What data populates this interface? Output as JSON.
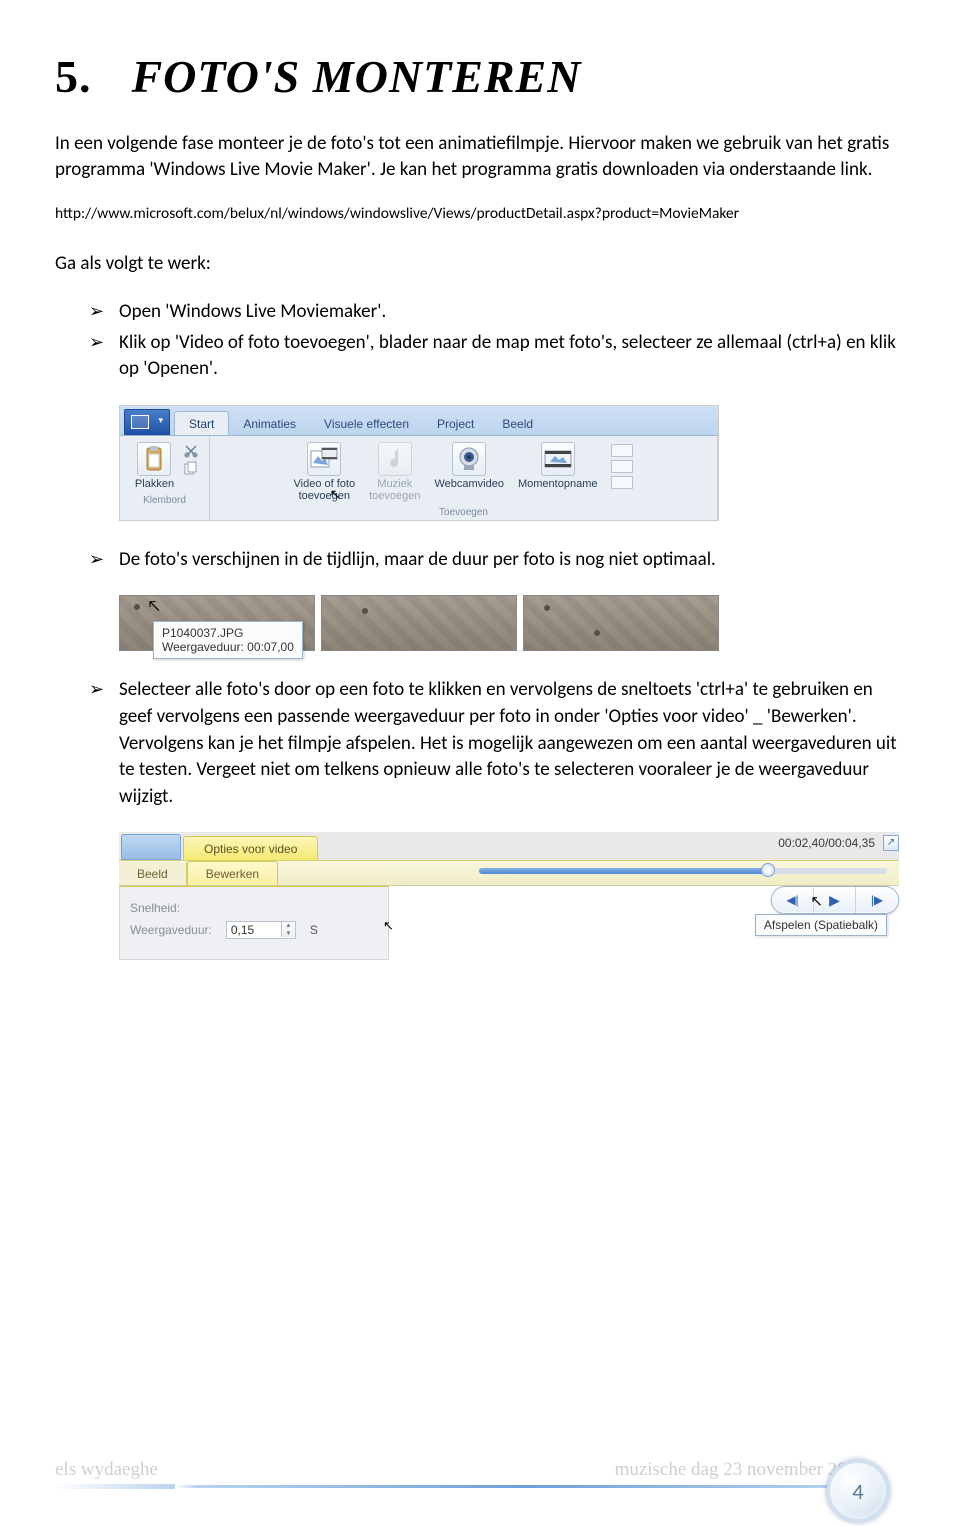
{
  "heading": {
    "number": "5.",
    "title": "FOTO'S MONTEREN"
  },
  "intro": "In een volgende fase monteer je de foto's tot een animatiefilmpje. Hiervoor maken we gebruik van het gratis programma 'Windows Live Movie Maker'. Je kan het programma gratis downloaden via onderstaande link.",
  "link": "http://www.microsoft.com/belux/nl/windows/windowslive/Views/productDetail.aspx?product=MovieMaker",
  "steps_intro": "Ga als volgt te werk:",
  "bullets": {
    "b1": "Open 'Windows Live Moviemaker'.",
    "b2": "Klik op 'Video of foto toevoegen', blader naar de map met foto's, selecteer ze allemaal (ctrl+a) en klik op 'Openen'.",
    "b3": "De foto's verschijnen in de tijdlijn, maar de duur per foto is nog niet optimaal.",
    "b4": "Selecteer alle foto's door op een foto te klikken en vervolgens de sneltoets 'ctrl+a' te gebruiken en geef vervolgens een passende weergaveduur per foto in onder 'Opties voor video' _ 'Bewerken'. Vervolgens kan je het filmpje afspelen. Het is mogelijk aangewezen om een aantal weergaveduren uit te testen. Vergeet niet om telkens opnieuw alle foto's te selecteren vooraleer je de weergaveduur wijzigt."
  },
  "ribbon": {
    "tabs": {
      "start": "Start",
      "animaties": "Animaties",
      "visuele": "Visuele effecten",
      "project": "Project",
      "beeld": "Beeld"
    },
    "items": {
      "plakken": "Plakken",
      "video": "Video of foto\ntoevoegen",
      "muziek": "Muziek\ntoevoegen",
      "webcam": "Webcamvideo",
      "moment": "Momentopname"
    },
    "groups": {
      "klembord": "Klembord",
      "toevoegen": "Toevoegen"
    }
  },
  "tooltip": {
    "line1": "P1040037.JPG",
    "line2": "Weergaveduur: 00:07,00"
  },
  "editor": {
    "tab_opts": "Opties voor video",
    "tab_beeld": "Beeld",
    "tab_bewerken": "Bewerken",
    "label_snelheid": "Snelheid:",
    "label_weergave": "Weergaveduur:",
    "val_weergave": "0,15",
    "trail": "S",
    "time": "00:02,40/00:04,35",
    "tooltip_play": "Afspelen (Spatiebalk)"
  },
  "footer": {
    "left": "els wydaeghe",
    "right": "muzische dag 23 november 2011",
    "page": "4"
  }
}
